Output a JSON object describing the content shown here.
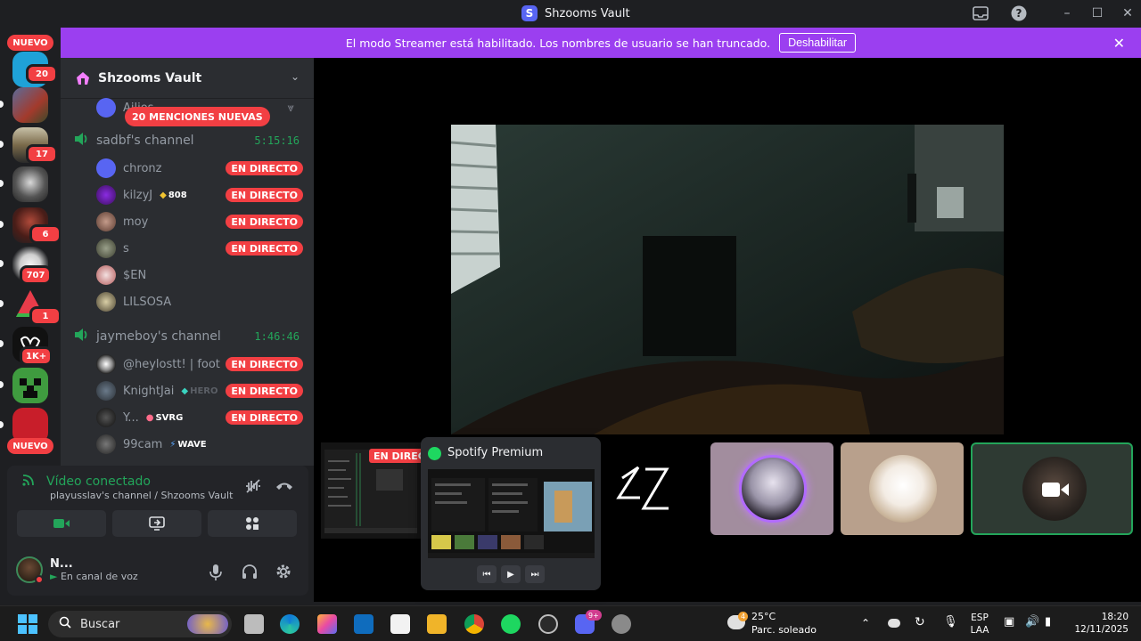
{
  "window": {
    "title": "Shzooms Vault"
  },
  "banner": {
    "text": "El modo Streamer está habilitado. Los nombres de usuario se han truncado.",
    "button": "Deshabilitar"
  },
  "rail": {
    "new_label": "NUEVO",
    "badges": [
      "20",
      "17",
      "6",
      "707",
      "1",
      "1K+"
    ],
    "new_label_bottom": "NUEVO"
  },
  "server": {
    "name": "Shzooms Vault",
    "mentions": "20 MENCIONES NUEVAS",
    "cut_user": "Ailios"
  },
  "channels": [
    {
      "name": "sadbf's channel",
      "timer": "5:15:16",
      "users": [
        {
          "name": "chronz",
          "live": "EN DIRECTO"
        },
        {
          "name": "kilzyJ",
          "tag": "808",
          "live": "EN DIRECTO"
        },
        {
          "name": "moy",
          "live": "EN DIRECTO"
        },
        {
          "name": "s",
          "live": "EN DIRECTO"
        },
        {
          "name": "$EN"
        },
        {
          "name": "LILSOSA"
        }
      ]
    },
    {
      "name": "jaymeboy's channel",
      "timer": "1:46:46",
      "users": [
        {
          "name": "@heylostt! | foot ba...",
          "live": "EN DIRECTO"
        },
        {
          "name": "KnightJai",
          "tag": "HERO",
          "live": "EN DIRECTO"
        },
        {
          "name": "Y...",
          "tag": "SVRG",
          "live": "EN DIRECTO"
        },
        {
          "name": "99cam",
          "tag": "WAVE"
        }
      ]
    }
  ],
  "voice": {
    "status": "Vídeo conectado",
    "channel": "playusslav's channel / Shzooms Vault"
  },
  "profile": {
    "name": "N...",
    "status": "En canal de voz"
  },
  "stage": {
    "live_tag": "EN DIREC",
    "spotify_title": "Spotify Premium",
    "logo_text": "ƧZ"
  },
  "taskbar": {
    "search": "Buscar",
    "weather_temp": "25°C",
    "weather_desc": "Parc. soleado",
    "weather_badge": "4",
    "lang1": "ESP",
    "lang2": "LAA",
    "time": "18:20",
    "date": "12/11/2025",
    "discord_badge": "9+"
  }
}
